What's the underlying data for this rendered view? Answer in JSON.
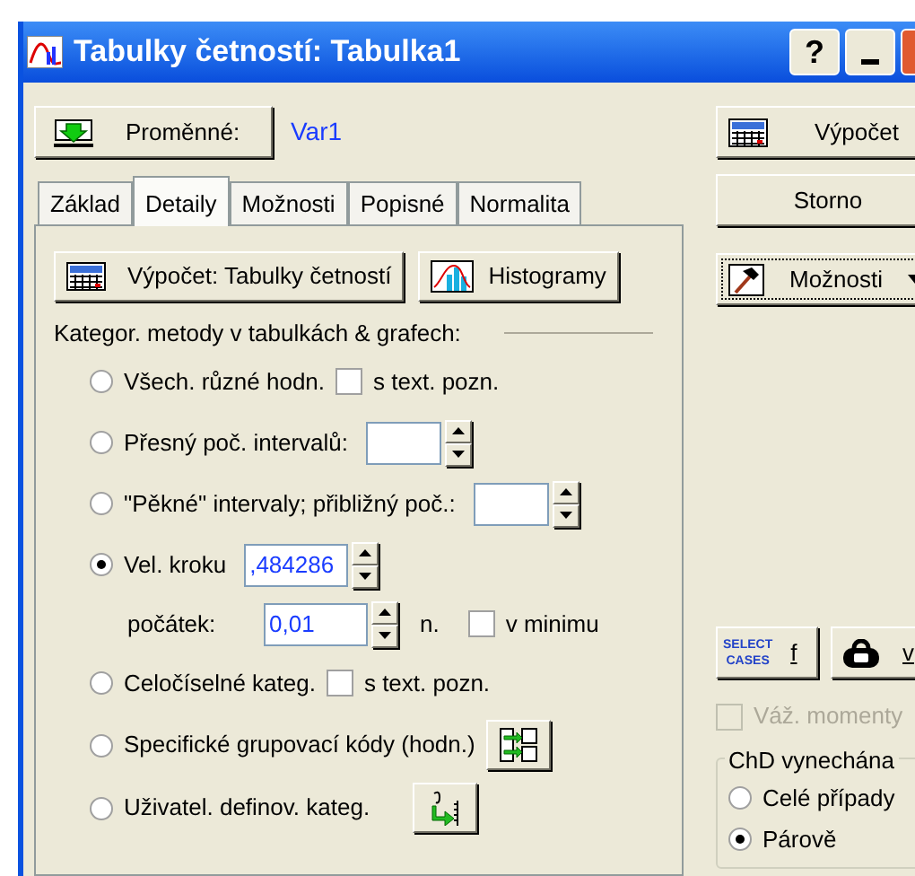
{
  "window": {
    "title": "Tabulky četností: Tabulka1",
    "help_button": "?"
  },
  "variables": {
    "button": "Proměnné:",
    "value": "Var1"
  },
  "tabs": [
    {
      "label": "Základ",
      "selected": false
    },
    {
      "label": "Detaily",
      "selected": true
    },
    {
      "label": "Možnosti",
      "selected": false
    },
    {
      "label": "Popisné",
      "selected": false
    },
    {
      "label": "Normalita",
      "selected": false
    }
  ],
  "panel": {
    "buttons": [
      "Výpočet: Tabulky četností",
      "Histogramy"
    ],
    "section_label": "Kategor. metody v tabulkách & grafech:",
    "options": [
      {
        "kind": "check",
        "label": "Všech. různé hodn.",
        "selected": false,
        "checkbox": {
          "label": "s text. pozn.",
          "checked": false
        }
      },
      {
        "kind": "spin",
        "label": "Přesný poč. intervalů:",
        "selected": false
      },
      {
        "kind": "spin",
        "label": "\"Pěkné\" intervaly; přibližný poč.:",
        "selected": false
      },
      {
        "kind": "spin",
        "label": "Vel. kroku",
        "selected": true,
        "value": ",484286",
        "sub": {
          "label": "počátek:",
          "value": "0,01",
          "suffix": "n.",
          "checkbox": {
            "label": "v minimu",
            "checked": false
          }
        }
      },
      {
        "kind": "check",
        "label": "Celočíselné kateg.",
        "selected": false,
        "checkbox": {
          "label": "s text. pozn.",
          "checked": false
        }
      },
      {
        "kind": "codes",
        "label": "Specifické grupovací kódy (hodn.)",
        "selected": false
      },
      {
        "kind": "user",
        "label": "Uživatel. definov. kateg.",
        "selected": false
      }
    ]
  },
  "side": {
    "buttons": [
      "Výpočet",
      "Storno"
    ],
    "options_button": "Možnosti",
    "select_cases": {
      "icon_text": [
        "SELECT",
        "CASES"
      ],
      "key": "f"
    },
    "weight_button": {
      "key": "v"
    },
    "weighted_moments": {
      "label": "Váž. momenty",
      "checked": false,
      "disabled": true
    },
    "missing": {
      "title": "ChD vynechána",
      "options": [
        {
          "label": "Celé případy",
          "selected": false
        },
        {
          "label": "Párově",
          "selected": true
        }
      ]
    }
  }
}
